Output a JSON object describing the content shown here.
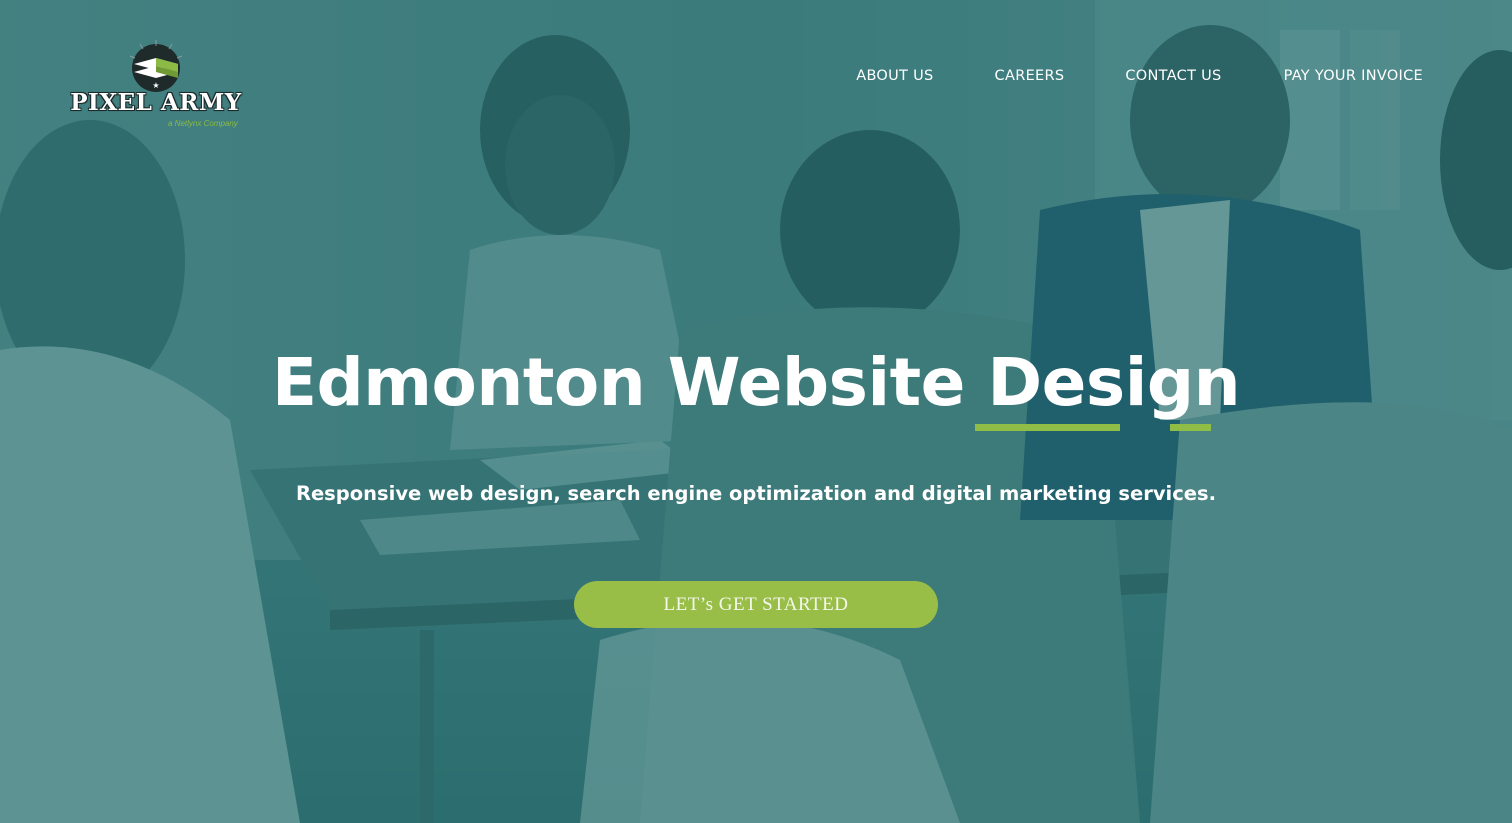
{
  "colors": {
    "overlay": "#20696c",
    "accent_green": "#8fbd46",
    "button_bg": "#99be47",
    "text": "#ffffff"
  },
  "brand": {
    "logo_name": "PIXEL ARMY",
    "logo_tagline": "a Netlynx Company",
    "logo_icon": "pixel-army-emblem-icon"
  },
  "nav": {
    "items": [
      {
        "label": "ABOUT US"
      },
      {
        "label": "CAREERS"
      },
      {
        "label": "CONTACT US"
      },
      {
        "label": "PAY YOUR INVOICE"
      }
    ]
  },
  "hero": {
    "title_main": "Edmonton Website ",
    "title_accent": "Design",
    "subtitle": "Responsive web design, search engine optimization and digital marketing services.",
    "cta_label": "LET’s GET STARTED"
  }
}
